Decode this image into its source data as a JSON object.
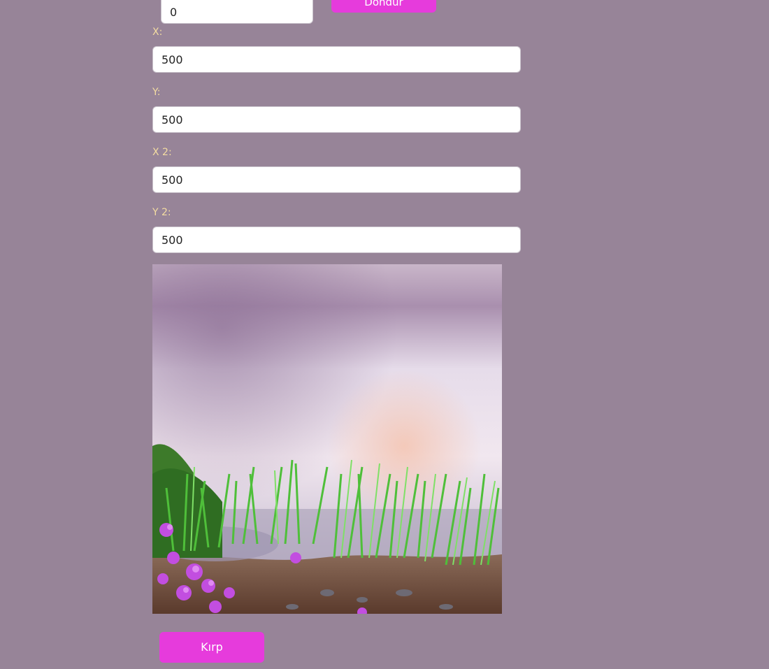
{
  "rotate": {
    "angle_value": "0",
    "button_label": "Döndür"
  },
  "fields": [
    {
      "label": "X:",
      "value": "500"
    },
    {
      "label": "Y:",
      "value": "500"
    },
    {
      "label": "X 2:",
      "value": "500"
    },
    {
      "label": "Y 2:",
      "value": "500"
    }
  ],
  "preview": {
    "icon": "landscape-lake-image"
  },
  "crop": {
    "button_label": "Kırp"
  },
  "colors": {
    "background": "#978498",
    "accent": "#e63bdc",
    "label": "#f4dda2"
  }
}
